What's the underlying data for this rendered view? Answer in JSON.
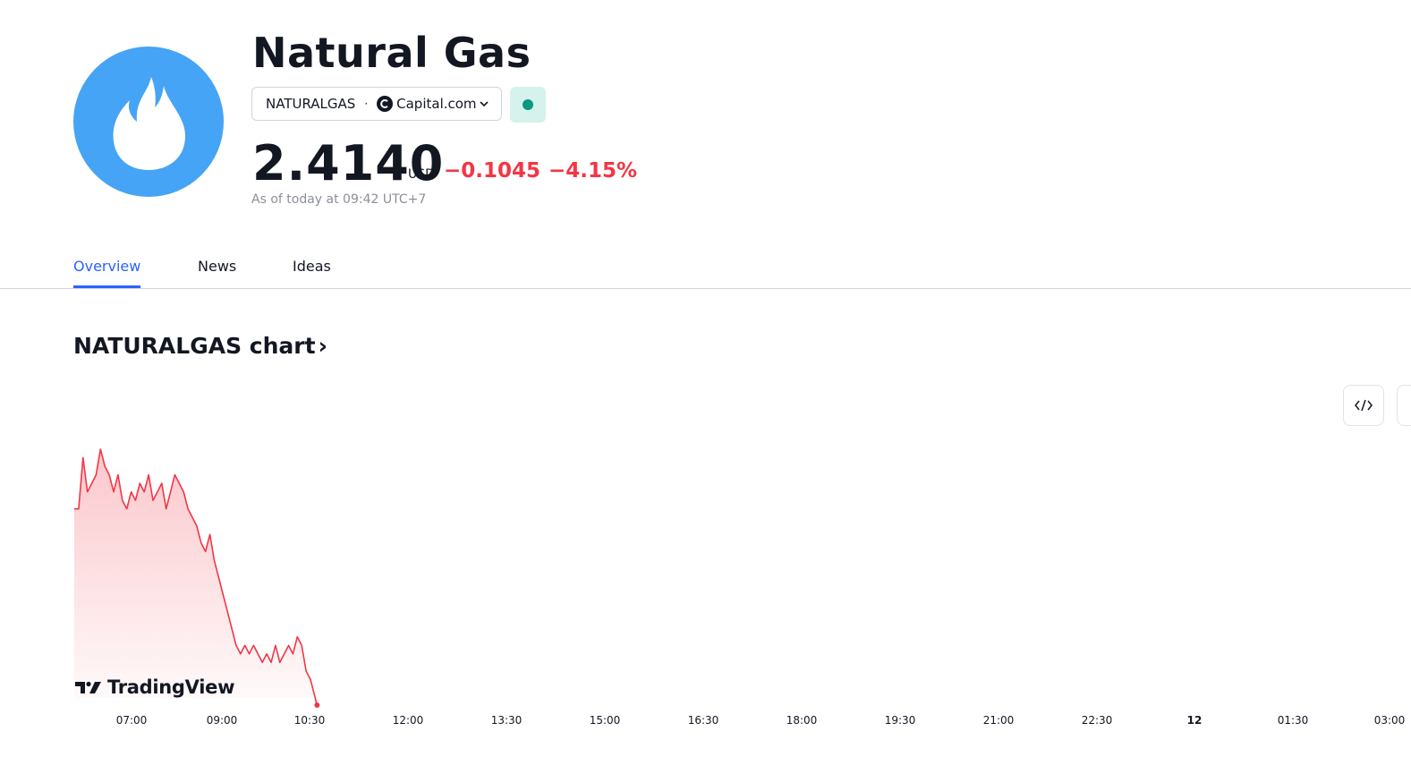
{
  "header": {
    "title": "Natural Gas",
    "logo_icon": "flame-icon",
    "logo_color": "#45a4f5",
    "symbol": "NATURALGAS",
    "separator": "·",
    "broker": "Capital.com",
    "status_color": "#089981"
  },
  "quote": {
    "price": "2.4140",
    "currency": "USD",
    "change": "−0.1045",
    "change_percent": "−4.15%",
    "change_color": "#f23645",
    "as_of": "As of today at 09:42 UTC+7"
  },
  "tabs": [
    {
      "label": "Overview",
      "active": true
    },
    {
      "label": "News",
      "active": false
    },
    {
      "label": "Ideas",
      "active": false
    }
  ],
  "chart_section": {
    "title": "NATURALGAS chart",
    "arrow": "›",
    "watermark": "TradingView"
  },
  "chart_data": {
    "type": "area",
    "line_color": "#f23645",
    "x_ticks": [
      "07:00",
      "09:00",
      "10:30",
      "12:00",
      "13:30",
      "15:00",
      "16:30",
      "18:00",
      "19:30",
      "21:00",
      "22:30",
      "12",
      "01:30",
      "03:00"
    ],
    "x": [
      "06:00",
      "06:04",
      "06:08",
      "06:12",
      "06:16",
      "06:20",
      "06:24",
      "06:28",
      "06:32",
      "06:36",
      "06:40",
      "06:44",
      "06:48",
      "06:52",
      "06:56",
      "07:00",
      "07:04",
      "07:08",
      "07:12",
      "07:16",
      "07:20",
      "07:24",
      "07:28",
      "07:32",
      "07:36",
      "07:40",
      "07:44",
      "07:48",
      "07:52",
      "07:56",
      "08:00",
      "08:04",
      "08:08",
      "08:12",
      "08:16",
      "08:20",
      "08:24",
      "08:28",
      "08:32",
      "08:36",
      "08:40",
      "08:44",
      "08:48",
      "08:52",
      "08:56",
      "09:00",
      "09:04",
      "09:08",
      "09:12",
      "09:16",
      "09:20",
      "09:24",
      "09:28",
      "09:32",
      "09:36",
      "09:40",
      "09:42"
    ],
    "values": [
      2.47,
      2.47,
      2.53,
      2.49,
      2.5,
      2.51,
      2.54,
      2.52,
      2.51,
      2.49,
      2.51,
      2.48,
      2.47,
      2.49,
      2.48,
      2.5,
      2.49,
      2.51,
      2.48,
      2.49,
      2.5,
      2.47,
      2.49,
      2.51,
      2.5,
      2.49,
      2.47,
      2.46,
      2.45,
      2.43,
      2.42,
      2.44,
      2.41,
      2.39,
      2.37,
      2.35,
      2.33,
      2.31,
      2.3,
      2.31,
      2.3,
      2.31,
      2.3,
      2.29,
      2.3,
      2.29,
      2.31,
      2.29,
      2.3,
      2.31,
      2.3,
      2.32,
      2.31,
      2.28,
      2.27,
      2.25,
      2.24
    ]
  }
}
